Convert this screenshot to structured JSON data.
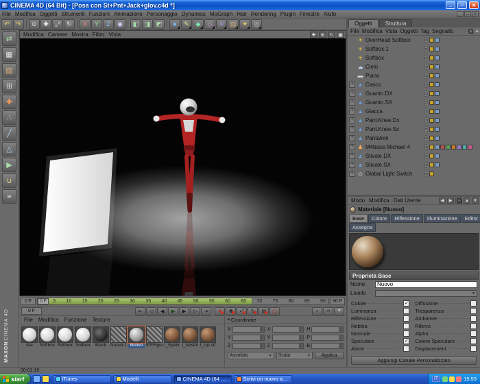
{
  "window": {
    "title": "CINEMA 4D (64 Bit) - [Posa con St+Pnt+Jack+glov.c4d *]",
    "controls": {
      "minimize": "_",
      "maximize": "□",
      "close": "✕"
    }
  },
  "menubar": [
    "File",
    "Modifica",
    "Oggetti",
    "Strumenti",
    "Funzioni",
    "Animazione",
    "Personaggio",
    "Dynamics",
    "MoGraph",
    "Hair",
    "Rendering",
    "Plugin",
    "Finestre",
    "Aiuto"
  ],
  "toolbar": [
    {
      "icon": "undo-icon"
    },
    {
      "icon": "redo-icon"
    },
    {
      "sep": true
    },
    {
      "icon": "live-selection-icon"
    },
    {
      "icon": "move-icon"
    },
    {
      "icon": "scale-icon"
    },
    {
      "icon": "rotate-icon"
    },
    {
      "sep": true
    },
    {
      "icon": "lock-x-icon"
    },
    {
      "icon": "lock-y-icon"
    },
    {
      "icon": "lock-z-icon"
    },
    {
      "icon": "coordinate-system-icon"
    },
    {
      "sep": true
    },
    {
      "icon": "render-view-icon"
    },
    {
      "icon": "render-picture-viewer-icon"
    },
    {
      "icon": "render-settings-icon"
    },
    {
      "sep": true
    },
    {
      "icon": "primitives-icon",
      "dropdown": true
    },
    {
      "icon": "splines-icon",
      "dropdown": true
    },
    {
      "icon": "generators-icon",
      "dropdown": true
    },
    {
      "icon": "modeling-icon",
      "dropdown": true
    },
    {
      "icon": "deformers-icon",
      "dropdown": true
    },
    {
      "icon": "scene-objects-icon",
      "dropdown": true
    },
    {
      "icon": "lights-icon",
      "dropdown": true
    },
    {
      "icon": "cameras-icon",
      "dropdown": true
    }
  ],
  "left_toolbar": [
    "make-editable-icon",
    "model-mode-icon",
    "texture-mode-icon",
    "workplane-mode-icon",
    "object-axis-mode-icon",
    "points-mode-icon",
    "edges-mode-icon",
    "polygons-mode-icon",
    "animation-mode-icon",
    "snap-mode-icon",
    "lock-axis-icon"
  ],
  "brand": {
    "maxon": "MAXON",
    "cinema": "CINEMA 4D"
  },
  "viewport": {
    "menu": [
      "Modifica",
      "Camere",
      "Mostra",
      "Filtro",
      "Vista"
    ],
    "nav_icons": [
      "pan-view-icon",
      "zoom-view-icon",
      "rotate-view-icon",
      "toggle-view-icon"
    ]
  },
  "object_manager": {
    "tabs": [
      "Oggetti",
      "Struttura"
    ],
    "active_tab": "Oggetti",
    "menu": [
      "File",
      "Modifica",
      "Vista",
      "Oggetti",
      "Tag",
      "Segnalib"
    ],
    "icons": [
      "search-icon",
      "options-icon"
    ],
    "objects": [
      {
        "name": "OverHead Softbox",
        "icon": "light-icon",
        "has_children": false,
        "tags": 2
      },
      {
        "name": "Softbox.1",
        "icon": "light-icon",
        "has_children": false,
        "tags": 2
      },
      {
        "name": "Softbox",
        "icon": "light-icon",
        "has_children": false,
        "tags": 2
      },
      {
        "name": "Cielo",
        "icon": "sky-icon",
        "has_children": false,
        "tags": 2
      },
      {
        "name": "Piano",
        "icon": "plane-icon",
        "has_children": false,
        "tags": 2
      },
      {
        "name": "Casco",
        "icon": "mesh-icon",
        "has_children": true,
        "tags": 2
      },
      {
        "name": "Guanto.DX",
        "icon": "mesh-icon",
        "has_children": true,
        "tags": 2
      },
      {
        "name": "Guanto.SX",
        "icon": "mesh-icon",
        "has_children": true,
        "tags": 2
      },
      {
        "name": "Giacca",
        "icon": "mesh-icon",
        "has_children": true,
        "tags": 2
      },
      {
        "name": "Pant.Knee.Dx",
        "icon": "mesh-icon",
        "has_children": true,
        "tags": 2
      },
      {
        "name": "Pant.Knee.Sx",
        "icon": "mesh-icon",
        "has_children": true,
        "tags": 2
      },
      {
        "name": "Pantaloni",
        "icon": "mesh-icon",
        "has_children": true,
        "tags": 2
      },
      {
        "name": "M4base.Michael 4",
        "icon": "figure-icon",
        "has_children": true,
        "tags": 8
      },
      {
        "name": "Stivale.DX",
        "icon": "mesh-icon",
        "has_children": true,
        "tags": 2
      },
      {
        "name": "Stivale.SX",
        "icon": "mesh-icon",
        "has_children": true,
        "tags": 2
      },
      {
        "name": "Global Light Switch",
        "icon": "null-icon",
        "has_children": true,
        "tags": 1
      }
    ]
  },
  "attributes": {
    "menu": [
      "Modo",
      "Modifica",
      "Dati Utente"
    ],
    "nav_icons": [
      "back-icon",
      "forward-icon",
      "search-icon",
      "up-icon",
      "filter-icon"
    ],
    "title": "Materiale [Nuovo]",
    "tabs": [
      "Base",
      "Colore",
      "Riflessione",
      "Illuminazione",
      "Editor"
    ],
    "active_tab": "Base",
    "tabs_row2": [
      "Assegna"
    ],
    "section_title": "Proprietà Base",
    "fields": {
      "nome_label": "Nome",
      "nome_value": "Nuovo",
      "livello_label": "Livello"
    },
    "channels_left": [
      {
        "label": "Colore",
        "checked": true
      },
      {
        "label": "Luminanza",
        "checked": false
      },
      {
        "label": "Riflessione",
        "checked": false
      },
      {
        "label": "Nebbia",
        "checked": false
      },
      {
        "label": "Normale",
        "checked": false
      },
      {
        "label": "Speculare",
        "checked": true
      },
      {
        "label": "Alone",
        "checked": false
      }
    ],
    "channels_right": [
      {
        "label": "Diffusione",
        "checked": false
      },
      {
        "label": "Trasparenza",
        "checked": false
      },
      {
        "label": "Ambiente",
        "checked": false
      },
      {
        "label": "Rilievo",
        "checked": false
      },
      {
        "label": "Alpha",
        "checked": false
      },
      {
        "label": "Colore Speculare",
        "checked": false
      },
      {
        "label": "Displacement",
        "checked": false
      }
    ],
    "add_channel_button": "Aggiungi Canale Personalizzato"
  },
  "timeline": {
    "ticks": [
      "0",
      "5",
      "10",
      "15",
      "20",
      "25",
      "30",
      "35",
      "40",
      "45",
      "50",
      "55",
      "60",
      "65",
      "70",
      "75",
      "80",
      "85",
      "90"
    ],
    "range_start_frame": "0 F",
    "range_end_frame": "90 F",
    "current_frame": "0 F",
    "preview_range_percent": 74
  },
  "transport": {
    "buttons": [
      "goto-start-icon",
      "prev-key-icon",
      "prev-frame-icon",
      "play-icon",
      "next-frame-icon",
      "next-key-icon",
      "goto-end-icon"
    ],
    "record_buttons": [
      "record-keyframe-icon",
      "record-position-icon",
      "record-scale-icon",
      "record-rotation-icon",
      "record-parameter-icon",
      "autokey-icon"
    ],
    "right_icons": [
      "sound-icon",
      "loop-icon",
      "options-icon"
    ]
  },
  "materials": {
    "menu": [
      "File",
      "Modifica",
      "Funzione",
      "Texture"
    ],
    "items": [
      {
        "label": "Kie",
        "type": "white",
        "selected": false
      },
      {
        "label": "Softbox",
        "type": "white",
        "selected": false
      },
      {
        "label": "Softbox",
        "type": "white",
        "selected": false
      },
      {
        "label": "Softbox",
        "type": "white",
        "selected": false
      },
      {
        "label": "Black",
        "type": "dark",
        "selected": false
      },
      {
        "label": "Nuova.1",
        "type": "hatch",
        "selected": false
      },
      {
        "label": "Nuovo",
        "type": "gray",
        "selected": true
      },
      {
        "label": "IPFFigur",
        "type": "hatch",
        "selected": false
      },
      {
        "label": "I_Eyebr",
        "type": "face",
        "selected": false
      },
      {
        "label": "I_Nostril",
        "type": "face",
        "selected": false
      },
      {
        "label": "I_Lip.stf",
        "type": "face",
        "selected": false
      }
    ]
  },
  "coordinates": {
    "title": "Coordinate",
    "position_rows": [
      {
        "label": "X",
        "value": ""
      },
      {
        "label": "Y",
        "value": ""
      },
      {
        "label": "Z",
        "value": ""
      }
    ],
    "scale_rows": [
      {
        "label": "X",
        "value": ""
      },
      {
        "label": "Y",
        "value": ""
      },
      {
        "label": "Z",
        "value": ""
      }
    ],
    "rotation_rows": [
      {
        "label": "H",
        "value": ""
      },
      {
        "label": "P",
        "value": ""
      },
      {
        "label": "B",
        "value": ""
      }
    ],
    "mode_dropdown": "Assoluto",
    "scale_dropdown": "Scala",
    "apply_button": "Applica"
  },
  "status": {
    "time": "00:01:10"
  },
  "taskbar": {
    "start": "start",
    "quick_launch": [
      "quicklaunch-icon-1",
      "quicklaunch-icon-2"
    ],
    "tasks": [
      {
        "label": "iTunes",
        "icon": "itunes-icon",
        "active": false
      },
      {
        "label": "Modelli",
        "icon": "folder-icon",
        "active": false
      },
      {
        "label": "CINEMA 4D (64 Bit) ...",
        "icon": "cinema4d-icon",
        "active": true
      },
      {
        "label": "Scrivi un nuovo arg...",
        "icon": "browser-icon",
        "active": false
      }
    ],
    "tray": {
      "language": "IT",
      "icons": [
        "antivirus-icon",
        "volume-icon",
        "network-icon"
      ],
      "time": "15:59"
    }
  }
}
